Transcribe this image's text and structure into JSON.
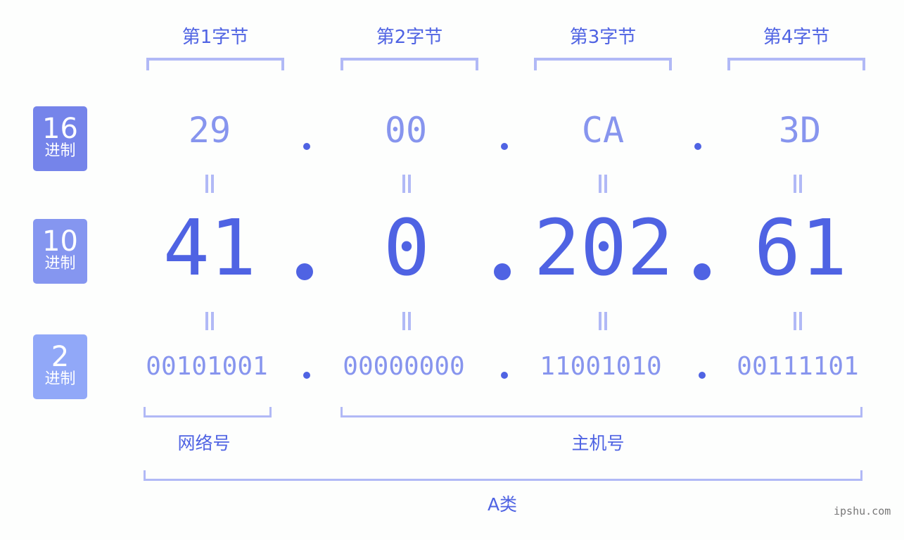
{
  "byte_labels": [
    "第1字节",
    "第2字节",
    "第3字节",
    "第4字节"
  ],
  "rows": {
    "hex": {
      "badge_num": "16",
      "badge_text": "进制",
      "values": [
        "29",
        "00",
        "CA",
        "3D"
      ],
      "badge_color": "#7584ea"
    },
    "dec": {
      "badge_num": "10",
      "badge_text": "进制",
      "values": [
        "41",
        "0",
        "202",
        "61"
      ],
      "badge_color": "#8596f0"
    },
    "bin": {
      "badge_num": "2",
      "badge_text": "进制",
      "values": [
        "00101001",
        "00000000",
        "11001010",
        "00111101"
      ],
      "badge_color": "#91a8f8"
    }
  },
  "equals_symbol": "=",
  "network_label": "网络号",
  "host_label": "主机号",
  "class_label": "A类",
  "watermark": "ipshu.com",
  "colors": {
    "accent": "#4f63e3",
    "light": "#8795ee",
    "bracket": "#b1b9f6"
  }
}
